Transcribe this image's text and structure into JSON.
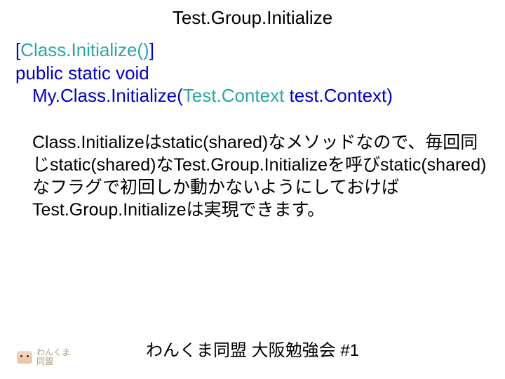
{
  "title": "Test.Group.Initialize",
  "code": {
    "bracket_open": "[",
    "attr": "Class.Initialize()",
    "bracket_close": "]",
    "modifiers": "public static void",
    "method_prefix": "My.Class.Initialize(",
    "param_type": "Test.Context",
    "param_rest": " test.Context)"
  },
  "explanation": "Class.Initializeはstatic(shared)なメソッドなので、毎回同じstatic(shared)なTest.Group.Initializeを呼びstatic(shared)なフラグで初回しか動かないようにしておけばTest.Group.Initializeは実現できます。",
  "logo": {
    "line1": "わんくま",
    "line2": "同盟"
  },
  "footer": "わんくま同盟 大阪勉強会 #1"
}
